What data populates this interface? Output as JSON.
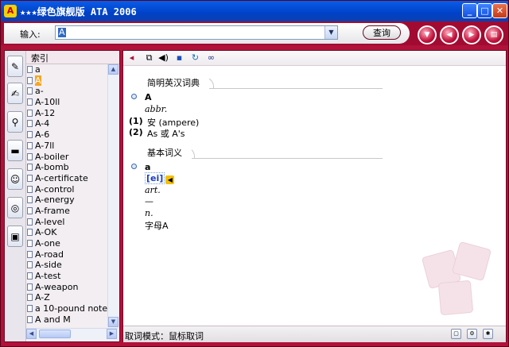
{
  "window": {
    "title": "★★★绿色旗舰版 ATA 2006"
  },
  "toolbar": {
    "input_label": "输入:",
    "search_value": "A",
    "query_button": "查询"
  },
  "nav_buttons": [
    "down-circle-icon",
    "back-icon",
    "forward-icon",
    "notebook-icon"
  ],
  "sidebar": {
    "index_label": "索引",
    "tool_icons": [
      "pencil-book-icon",
      "edit-icon",
      "magnifier-icon",
      "book-icon",
      "people-icon",
      "globe-icon",
      "clipboard-icon"
    ],
    "words": [
      "a",
      "A",
      "a-",
      "A-10ll",
      "A-12",
      "A-4",
      "A-6",
      "A-7ll",
      "A-boiler",
      "A-bomb",
      "A-certificate",
      "A-control",
      "A-energy",
      "A-frame",
      "A-level",
      "A-OK",
      "A-one",
      "A-road",
      "A-side",
      "A-test",
      "A-weapon",
      "A-Z",
      "a 10-pound note",
      "A and M"
    ],
    "selected_index": 1
  },
  "content": {
    "toolbar_icons": [
      "back-arrow-icon",
      "copy-icon",
      "speaker-icon",
      "save-icon",
      "refresh-icon",
      "binoculars-icon"
    ],
    "section1": {
      "title": "简明英汉词典",
      "headword": "A",
      "pos": "abbr.",
      "senses": [
        {
          "num": "(1)",
          "text": "安 (ampere)"
        },
        {
          "num": "(2)",
          "text": "As 或 A's"
        }
      ]
    },
    "section2": {
      "title": "基本词义",
      "headword": "a",
      "phonetic": "[ei]",
      "pos1": "art.",
      "dash": "—",
      "pos2": "n.",
      "meaning": "字母A"
    },
    "status": "取词模式：鼠标取词",
    "status_icons": [
      "window-icon",
      "settings-icon",
      "tools-icon"
    ]
  }
}
